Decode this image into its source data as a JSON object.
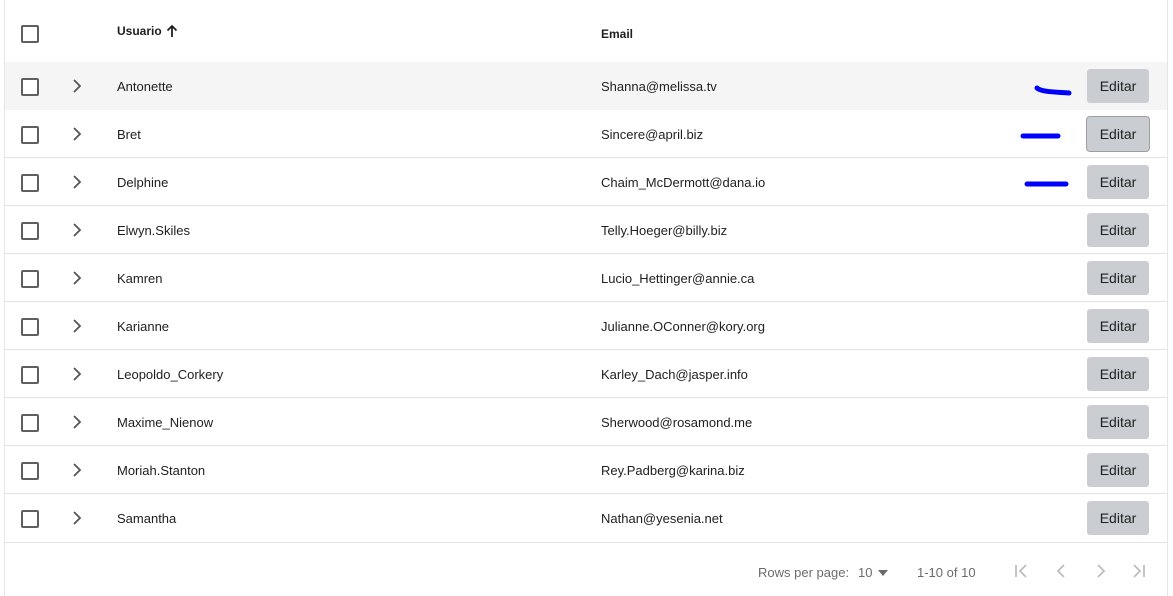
{
  "header": {
    "user_label": "Usuario",
    "email_label": "Email"
  },
  "rows": [
    {
      "user": "Antonette",
      "email": "Shanna@melissa.tv",
      "action": "Editar"
    },
    {
      "user": "Bret",
      "email": "Sincere@april.biz",
      "action": "Editar"
    },
    {
      "user": "Delphine",
      "email": "Chaim_McDermott@dana.io",
      "action": "Editar"
    },
    {
      "user": "Elwyn.Skiles",
      "email": "Telly.Hoeger@billy.biz",
      "action": "Editar"
    },
    {
      "user": "Kamren",
      "email": "Lucio_Hettinger@annie.ca",
      "action": "Editar"
    },
    {
      "user": "Karianne",
      "email": "Julianne.OConner@kory.org",
      "action": "Editar"
    },
    {
      "user": "Leopoldo_Corkery",
      "email": "Karley_Dach@jasper.info",
      "action": "Editar"
    },
    {
      "user": "Maxime_Nienow",
      "email": "Sherwood@rosamond.me",
      "action": "Editar"
    },
    {
      "user": "Moriah.Stanton",
      "email": "Rey.Padberg@karina.biz",
      "action": "Editar"
    },
    {
      "user": "Samantha",
      "email": "Nathan@yesenia.net",
      "action": "Editar"
    }
  ],
  "pagination": {
    "rows_per_page_label": "Rows per page:",
    "rows_per_page_value": "10",
    "range": "1-10 of 10"
  },
  "colors": {
    "button_bg": "#cacdd2",
    "annotation_blue": "#0000ff",
    "row_highlight": "#f5f5f5"
  },
  "icons": {
    "sort": "arrow-up-icon",
    "expand": "chevron-right-icon",
    "first": "first-page-icon",
    "prev": "chevron-left-icon",
    "next": "chevron-right-icon",
    "last": "last-page-icon",
    "dropdown": "caret-down-icon"
  }
}
